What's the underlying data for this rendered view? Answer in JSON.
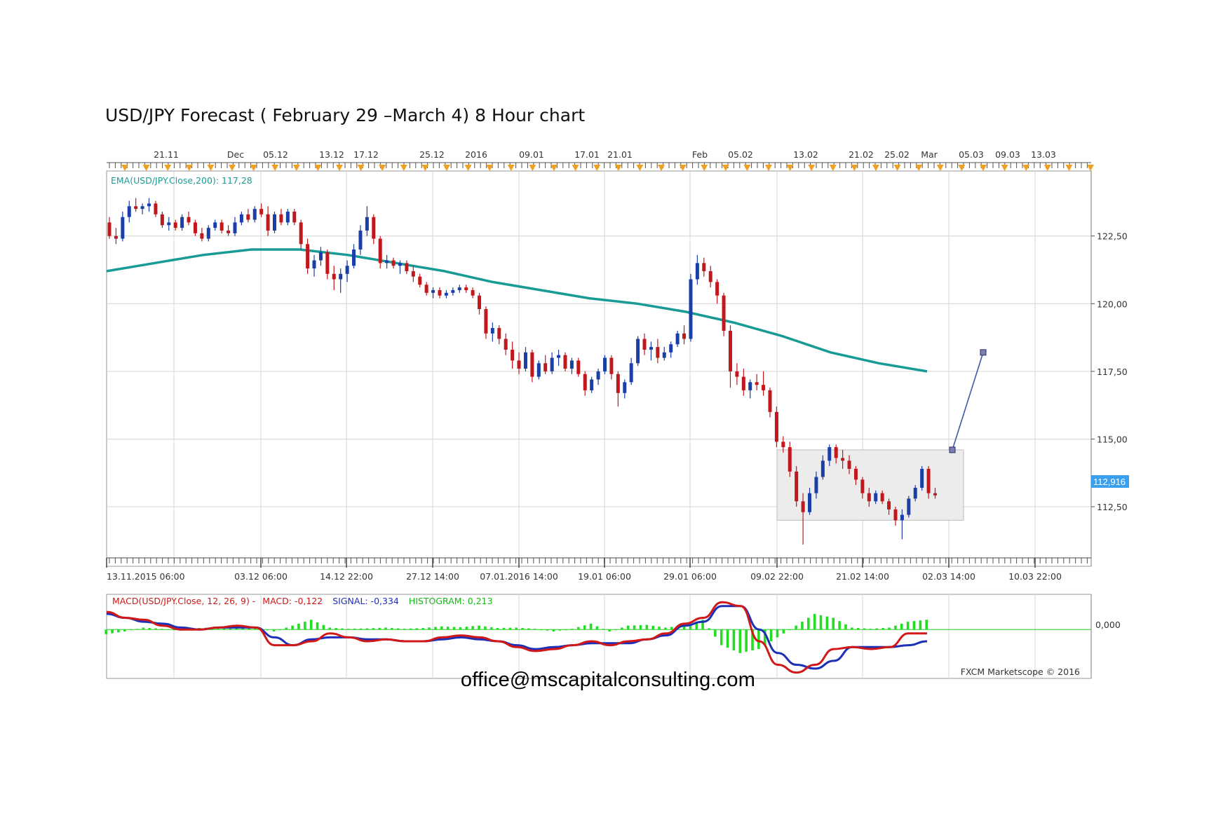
{
  "title": "USD/JPY Forecast ( February 29 –March 4) 8 Hour chart",
  "email": "office@mscapitalconsulting.com",
  "copyright": "FXCM Marketscope © 2016",
  "colors": {
    "up": "#1a3fa8",
    "down": "#c0181c",
    "ema": "#189b95",
    "macd": "#d01818",
    "signal": "#1c2fb8",
    "histogram": "#22dd22",
    "grid": "#d4d4d4",
    "price_tag": "#3aa0ee",
    "box_fill": "#ececec",
    "box_stroke": "#bdbdbd",
    "projection": "#3a5aa8"
  },
  "chart_data": [
    {
      "type": "candlestick",
      "title": "",
      "indicator_label": "EMA(USD/JPY.Close,200): 117,28",
      "last_price_label": "112,916",
      "grid": true,
      "y_axis_side": "right",
      "ylim": [
        110.3,
        124.9
      ],
      "y_ticks": [
        112.5,
        115.0,
        117.5,
        120.0,
        122.5
      ],
      "y_tick_labels": [
        "112,50",
        "115,00",
        "117,50",
        "120,00",
        "122,50"
      ],
      "top_axis_labels": [
        "21.11",
        "Dec",
        "05.12",
        "13.12",
        "17.12",
        "25.12",
        "2016",
        "09.01",
        "17.01",
        "21.01",
        "Feb",
        "05.02",
        "13.02",
        "21.02",
        "25.02",
        "Mar",
        "05.03",
        "09.03",
        "13.03"
      ],
      "bottom_axis_labels": [
        "13.11.2015 06:00",
        "03.12 06:00",
        "14.12 22:00",
        "27.12 14:00",
        "07.01.2016 14:00",
        "19.01 06:00",
        "29.01 06:00",
        "09.02 22:00",
        "21.02 14:00",
        "02.03 14:00",
        "10.03 22:00"
      ],
      "ohlc": [
        [
          123.0,
          123.2,
          122.4,
          122.5
        ],
        [
          122.5,
          122.8,
          122.2,
          122.4
        ],
        [
          122.4,
          123.4,
          122.3,
          123.2
        ],
        [
          123.2,
          123.8,
          123.0,
          123.6
        ],
        [
          123.6,
          123.9,
          123.4,
          123.5
        ],
        [
          123.5,
          123.7,
          123.3,
          123.6
        ],
        [
          123.6,
          123.9,
          123.4,
          123.7
        ],
        [
          123.7,
          123.8,
          123.2,
          123.3
        ],
        [
          123.3,
          123.4,
          122.8,
          122.9
        ],
        [
          122.9,
          123.2,
          122.7,
          123.0
        ],
        [
          123.0,
          123.1,
          122.7,
          122.8
        ],
        [
          122.8,
          123.3,
          122.7,
          123.2
        ],
        [
          123.2,
          123.4,
          122.9,
          123.0
        ],
        [
          123.0,
          123.1,
          122.5,
          122.6
        ],
        [
          122.6,
          122.8,
          122.3,
          122.4
        ],
        [
          122.4,
          122.9,
          122.3,
          122.8
        ],
        [
          122.8,
          123.1,
          122.7,
          123.0
        ],
        [
          123.0,
          123.1,
          122.6,
          122.7
        ],
        [
          122.7,
          122.9,
          122.5,
          122.6
        ],
        [
          122.6,
          123.2,
          122.5,
          123.0
        ],
        [
          123.0,
          123.4,
          122.9,
          123.3
        ],
        [
          123.3,
          123.5,
          123.0,
          123.1
        ],
        [
          123.1,
          123.6,
          123.0,
          123.5
        ],
        [
          123.5,
          123.7,
          123.2,
          123.3
        ],
        [
          123.3,
          123.6,
          122.5,
          122.7
        ],
        [
          122.7,
          123.4,
          122.6,
          123.3
        ],
        [
          123.3,
          123.5,
          122.9,
          123.0
        ],
        [
          123.0,
          123.5,
          122.9,
          123.4
        ],
        [
          123.4,
          123.5,
          122.9,
          123.0
        ],
        [
          123.0,
          123.1,
          122.0,
          122.2
        ],
        [
          122.2,
          122.4,
          121.1,
          121.3
        ],
        [
          121.3,
          121.8,
          121.0,
          121.6
        ],
        [
          121.6,
          122.1,
          121.4,
          121.9
        ],
        [
          121.9,
          122.0,
          120.9,
          121.1
        ],
        [
          121.1,
          121.4,
          120.5,
          120.9
        ],
        [
          120.9,
          121.3,
          120.4,
          121.1
        ],
        [
          121.1,
          121.6,
          120.8,
          121.4
        ],
        [
          121.4,
          122.2,
          121.3,
          122.0
        ],
        [
          122.0,
          122.9,
          121.8,
          122.7
        ],
        [
          122.7,
          123.6,
          122.5,
          123.2
        ],
        [
          123.2,
          123.3,
          122.2,
          122.4
        ],
        [
          122.4,
          122.5,
          121.3,
          121.5
        ],
        [
          121.5,
          121.8,
          121.3,
          121.6
        ],
        [
          121.6,
          121.7,
          121.3,
          121.4
        ],
        [
          121.4,
          121.6,
          121.1,
          121.5
        ],
        [
          121.5,
          121.6,
          121.1,
          121.2
        ],
        [
          121.2,
          121.4,
          120.8,
          121.0
        ],
        [
          121.0,
          121.1,
          120.6,
          120.7
        ],
        [
          120.7,
          120.8,
          120.3,
          120.4
        ],
        [
          120.4,
          120.6,
          120.2,
          120.5
        ],
        [
          120.5,
          120.6,
          120.2,
          120.3
        ],
        [
          120.3,
          120.5,
          120.2,
          120.4
        ],
        [
          120.4,
          120.6,
          120.3,
          120.5
        ],
        [
          120.5,
          120.7,
          120.4,
          120.6
        ],
        [
          120.6,
          120.7,
          120.4,
          120.5
        ],
        [
          120.5,
          120.6,
          120.2,
          120.3
        ],
        [
          120.3,
          120.4,
          119.6,
          119.8
        ],
        [
          119.8,
          119.9,
          118.7,
          118.9
        ],
        [
          118.9,
          119.3,
          118.6,
          119.1
        ],
        [
          119.1,
          119.2,
          118.5,
          118.7
        ],
        [
          118.7,
          118.9,
          118.1,
          118.3
        ],
        [
          118.3,
          118.6,
          117.6,
          117.9
        ],
        [
          117.9,
          118.2,
          117.4,
          117.6
        ],
        [
          117.6,
          118.4,
          117.5,
          118.2
        ],
        [
          118.2,
          118.3,
          117.1,
          117.3
        ],
        [
          117.3,
          117.9,
          117.2,
          117.8
        ],
        [
          117.8,
          118.1,
          117.4,
          117.5
        ],
        [
          117.5,
          118.2,
          117.4,
          118.0
        ],
        [
          118.0,
          118.3,
          117.7,
          118.1
        ],
        [
          118.1,
          118.2,
          117.5,
          117.6
        ],
        [
          117.6,
          118.0,
          117.4,
          117.9
        ],
        [
          117.9,
          118.0,
          117.3,
          117.4
        ],
        [
          117.4,
          117.5,
          116.6,
          116.8
        ],
        [
          116.8,
          117.3,
          116.7,
          117.2
        ],
        [
          117.2,
          117.6,
          117.0,
          117.5
        ],
        [
          117.5,
          118.1,
          117.4,
          118.0
        ],
        [
          118.0,
          118.1,
          117.2,
          117.4
        ],
        [
          117.4,
          117.5,
          116.2,
          116.7
        ],
        [
          116.7,
          117.2,
          116.5,
          117.1
        ],
        [
          117.1,
          118.0,
          117.0,
          117.8
        ],
        [
          117.8,
          118.8,
          117.7,
          118.7
        ],
        [
          118.7,
          118.9,
          118.1,
          118.3
        ],
        [
          118.3,
          118.6,
          117.9,
          118.4
        ],
        [
          118.4,
          118.7,
          117.8,
          118.0
        ],
        [
          118.0,
          118.4,
          117.9,
          118.2
        ],
        [
          118.2,
          118.6,
          118.0,
          118.5
        ],
        [
          118.5,
          119.0,
          118.4,
          118.9
        ],
        [
          118.9,
          119.2,
          118.5,
          118.7
        ],
        [
          118.7,
          121.1,
          118.6,
          120.9
        ],
        [
          120.9,
          121.8,
          120.7,
          121.5
        ],
        [
          121.5,
          121.7,
          121.0,
          121.2
        ],
        [
          121.2,
          121.4,
          120.6,
          120.8
        ],
        [
          120.8,
          120.9,
          120.0,
          120.3
        ],
        [
          120.3,
          120.4,
          118.8,
          119.0
        ],
        [
          119.0,
          119.2,
          116.9,
          117.5
        ],
        [
          117.5,
          117.8,
          117.0,
          117.3
        ],
        [
          117.3,
          117.6,
          116.6,
          116.8
        ],
        [
          116.8,
          117.2,
          116.5,
          117.1
        ],
        [
          117.1,
          117.4,
          116.8,
          117.0
        ],
        [
          117.0,
          117.5,
          116.6,
          116.8
        ],
        [
          116.8,
          116.9,
          115.8,
          116.0
        ],
        [
          116.0,
          116.2,
          114.7,
          114.9
        ],
        [
          114.9,
          115.1,
          114.5,
          114.7
        ],
        [
          114.7,
          114.9,
          113.6,
          113.8
        ],
        [
          113.8,
          114.0,
          112.5,
          112.7
        ],
        [
          112.7,
          113.0,
          111.1,
          112.3
        ],
        [
          112.3,
          113.2,
          112.2,
          113.0
        ],
        [
          113.0,
          113.8,
          112.8,
          113.6
        ],
        [
          113.6,
          114.4,
          113.5,
          114.2
        ],
        [
          114.2,
          114.8,
          114.0,
          114.7
        ],
        [
          114.7,
          114.8,
          114.1,
          114.3
        ],
        [
          114.3,
          114.6,
          113.9,
          114.2
        ],
        [
          114.2,
          114.4,
          113.7,
          113.9
        ],
        [
          113.9,
          114.0,
          113.3,
          113.5
        ],
        [
          113.5,
          113.6,
          112.8,
          113.0
        ],
        [
          113.0,
          113.2,
          112.5,
          112.7
        ],
        [
          112.7,
          113.1,
          112.6,
          113.0
        ],
        [
          113.0,
          113.1,
          112.6,
          112.7
        ],
        [
          112.7,
          112.8,
          112.2,
          112.4
        ],
        [
          112.4,
          112.5,
          111.8,
          112.0
        ],
        [
          112.0,
          112.4,
          111.3,
          112.2
        ],
        [
          112.2,
          112.9,
          112.1,
          112.8
        ],
        [
          112.8,
          113.3,
          112.7,
          113.2
        ],
        [
          113.2,
          114.0,
          113.1,
          113.9
        ],
        [
          113.9,
          114.0,
          112.8,
          113.0
        ],
        [
          113.0,
          113.2,
          112.8,
          112.92
        ]
      ],
      "ema": [
        121.2,
        121.5,
        121.8,
        122.0,
        122.0,
        121.8,
        121.5,
        121.2,
        120.8,
        120.5,
        120.2,
        120.0,
        119.7,
        119.3,
        118.8,
        118.2,
        117.8,
        117.5
      ],
      "consolidation_box": {
        "x": [
          "09.02 22:00",
          "02.03 14:00"
        ],
        "y": [
          112.0,
          114.6
        ]
      },
      "projection": {
        "from": 114.6,
        "to": 118.2
      }
    },
    {
      "type": "line",
      "title": "MACD(USD/JPY.Close, 12, 26, 9)",
      "legend": [
        "MACD(USD/JPY.Close, 12, 26, 9) -",
        "MACD: -0,122",
        "SIGNAL: -0,334",
        "HISTOGRAM: 0,213"
      ],
      "y_tick_labels": [
        "0,000"
      ],
      "ylim": [
        -1.25,
        0.9
      ],
      "series": [
        {
          "name": "MACD",
          "values": [
            0.45,
            0.3,
            0.25,
            0.1,
            0.0,
            0.0,
            0.05,
            0.1,
            0.05,
            -0.4,
            -0.4,
            -0.3,
            -0.1,
            -0.2,
            -0.3,
            -0.25,
            -0.3,
            -0.3,
            -0.2,
            -0.15,
            -0.2,
            -0.3,
            -0.45,
            -0.55,
            -0.5,
            -0.4,
            -0.3,
            -0.4,
            -0.3,
            -0.25,
            -0.1,
            0.15,
            0.3,
            0.7,
            0.6,
            -0.3,
            -0.9,
            -1.1,
            -0.9,
            -0.5,
            -0.45,
            -0.5,
            -0.45,
            -0.1,
            -0.1
          ]
        },
        {
          "name": "SIGNAL",
          "values": [
            0.4,
            0.3,
            0.2,
            0.15,
            0.05,
            0.0,
            0.05,
            0.05,
            0.05,
            -0.2,
            -0.4,
            -0.25,
            -0.2,
            -0.2,
            -0.25,
            -0.25,
            -0.3,
            -0.3,
            -0.25,
            -0.2,
            -0.25,
            -0.3,
            -0.4,
            -0.5,
            -0.45,
            -0.4,
            -0.35,
            -0.35,
            -0.35,
            -0.25,
            -0.15,
            0.1,
            0.2,
            0.6,
            0.6,
            0.0,
            -0.6,
            -0.9,
            -1.0,
            -0.8,
            -0.45,
            -0.45,
            -0.45,
            -0.4,
            -0.3
          ]
        },
        {
          "name": "HISTOGRAM",
          "values": [
            -0.12,
            -0.05,
            0.05,
            0.02,
            -0.03,
            0.04,
            0.06,
            0.03,
            0.05,
            -0.05,
            0.1,
            0.25,
            0.05,
            0.02,
            0.03,
            0.05,
            0.02,
            0.04,
            0.08,
            0.06,
            0.1,
            0.04,
            0.05,
            0.02,
            -0.05,
            0.02,
            0.15,
            -0.05,
            0.1,
            0.12,
            0.05,
            0.1,
            0.25,
            -0.4,
            -0.6,
            -0.5,
            -0.2,
            0.1,
            0.4,
            0.3,
            0.05,
            0.02,
            0.05,
            0.2,
            0.25
          ]
        }
      ]
    }
  ]
}
